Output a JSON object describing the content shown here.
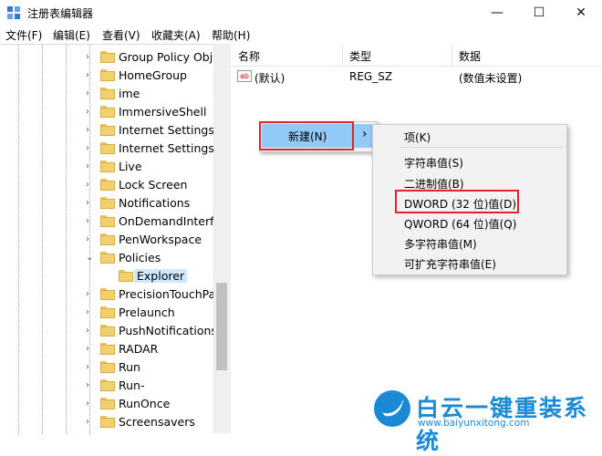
{
  "window": {
    "title": "注册表编辑器",
    "minimize": "—",
    "maximize": "☐",
    "close": "✕"
  },
  "menubar": [
    "文件(F)",
    "编辑(E)",
    "查看(V)",
    "收藏夹(A)",
    "帮助(H)"
  ],
  "tree": {
    "items": [
      {
        "label": "Group Policy Obje"
      },
      {
        "label": "HomeGroup"
      },
      {
        "label": "ime"
      },
      {
        "label": "ImmersiveShell"
      },
      {
        "label": "Internet Settings"
      },
      {
        "label": "Internet SettingsW"
      },
      {
        "label": "Live"
      },
      {
        "label": "Lock Screen"
      },
      {
        "label": "Notifications"
      },
      {
        "label": "OnDemandInterfa"
      },
      {
        "label": "PenWorkspace"
      },
      {
        "label": "Policies"
      },
      {
        "label": "Explorer"
      },
      {
        "label": "PrecisionTouchPa"
      },
      {
        "label": "Prelaunch"
      },
      {
        "label": "PushNotifications"
      },
      {
        "label": "RADAR"
      },
      {
        "label": "Run"
      },
      {
        "label": "Run-"
      },
      {
        "label": "RunOnce"
      },
      {
        "label": "Screensavers"
      }
    ]
  },
  "list": {
    "headers": [
      "名称",
      "类型",
      "数据"
    ],
    "rows": [
      {
        "icon": "ab",
        "name": "(默认)",
        "type": "REG_SZ",
        "data": "(数值未设置)"
      }
    ]
  },
  "context_menu": {
    "new_label": "新建(N)",
    "arrow": "›"
  },
  "submenu": {
    "items": [
      "项(K)",
      "字符串值(S)",
      "二进制值(B)",
      "DWORD (32 位)值(D)",
      "QWORD (64 位)值(Q)",
      "多字符串值(M)",
      "可扩充字符串值(E)"
    ]
  },
  "watermark": {
    "brand": "白云一键重装系统",
    "url": "www.baiyunxitong.com"
  },
  "colors": {
    "highlight": "#91c9f7",
    "red_box": "#e1242b",
    "watermark": "#1a8ad5"
  }
}
